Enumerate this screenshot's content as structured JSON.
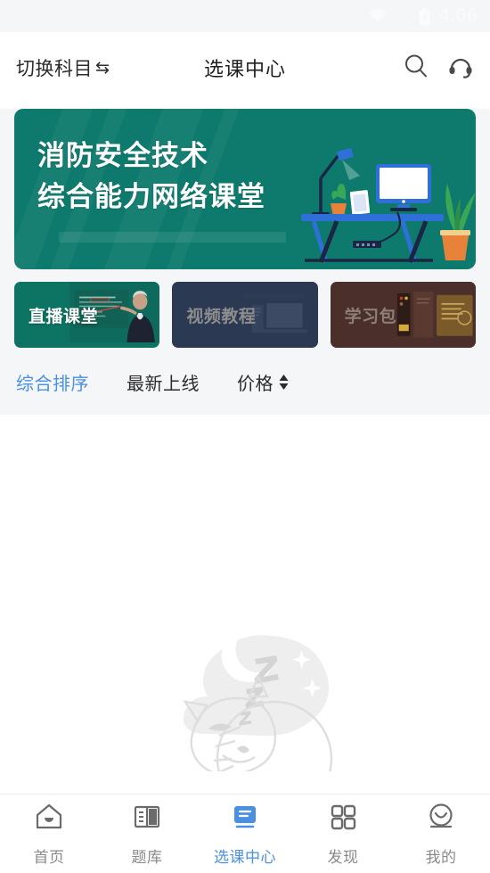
{
  "status_bar": {
    "time": "4:06",
    "icons": [
      "wifi-icon",
      "signal-off-icon",
      "battery-charging-icon"
    ]
  },
  "header": {
    "switch_subject_label": "切换科目",
    "switch_subject_icon": "swap-arrows-icon",
    "title": "选课中心",
    "search_icon": "search-icon",
    "support_icon": "headset-icon"
  },
  "banner": {
    "line1": "消防安全技术",
    "line2": "综合能力网络课堂",
    "bg_color": "#0e7a6d",
    "art": "desk-workspace-illustration"
  },
  "category_cards": [
    {
      "label": "直播课堂",
      "theme": "live",
      "bg_color": "#0d7464",
      "active": true
    },
    {
      "label": "视频教程",
      "theme": "video",
      "bg_color": "#2c3953",
      "active": false
    },
    {
      "label": "学习包",
      "theme": "pack",
      "bg_color": "#4b2f2a",
      "active": false
    }
  ],
  "sort_bar": {
    "items": [
      {
        "label": "综合排序",
        "active": true,
        "has_arrows": false
      },
      {
        "label": "最新上线",
        "active": false,
        "has_arrows": false
      },
      {
        "label": "价格",
        "active": false,
        "has_arrows": true
      }
    ],
    "active_color": "#4a90e2"
  },
  "empty_state": {
    "illustration": "sleeping-cat-moon-stars-watermark"
  },
  "bottom_nav": {
    "active_color": "#4a90e2",
    "inactive_color": "#8a8a8a",
    "items": [
      {
        "label": "首页",
        "icon": "home-icon",
        "active": false
      },
      {
        "label": "题库",
        "icon": "book-icon",
        "active": false
      },
      {
        "label": "选课中心",
        "icon": "course-icon",
        "active": true
      },
      {
        "label": "发现",
        "icon": "grid-icon",
        "active": false
      },
      {
        "label": "我的",
        "icon": "smiley-icon",
        "active": false
      }
    ]
  }
}
